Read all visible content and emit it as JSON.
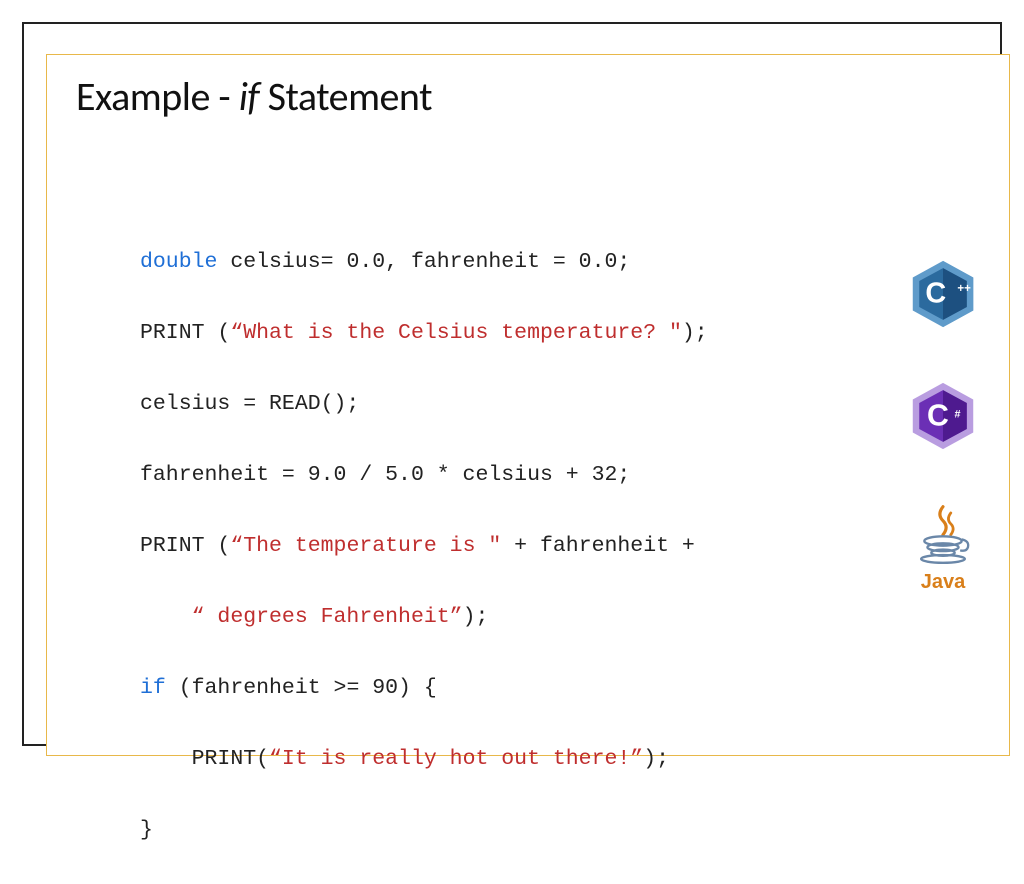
{
  "title": {
    "pre": "Example - ",
    "italic": "if",
    "post": " Statement"
  },
  "code": {
    "l1": {
      "kw": "double",
      "rest": " celsius= 0.0, fahrenheit = 0.0;"
    },
    "l2": {
      "pre": "PRINT (",
      "str": "“What is the Celsius temperature? \"",
      "post": ");"
    },
    "l3": "celsius = READ();",
    "l4": "fahrenheit = 9.0 / 5.0 * celsius + 32;",
    "l5": {
      "pre": "PRINT (",
      "str": "“The temperature is \"",
      "post": " + fahrenheit +"
    },
    "l6": {
      "pre": "    ",
      "str": "“ degrees Fahrenheit”",
      "post": ");"
    },
    "l7": {
      "kw": "if",
      "rest": " (fahrenheit >= 90) {"
    },
    "l8": {
      "pre": "    PRINT(",
      "str": "“It is really hot out there!”",
      "post": ");"
    },
    "l9": "}"
  },
  "icons": {
    "cpp": "C++",
    "cs": "C#",
    "java": "Java"
  }
}
